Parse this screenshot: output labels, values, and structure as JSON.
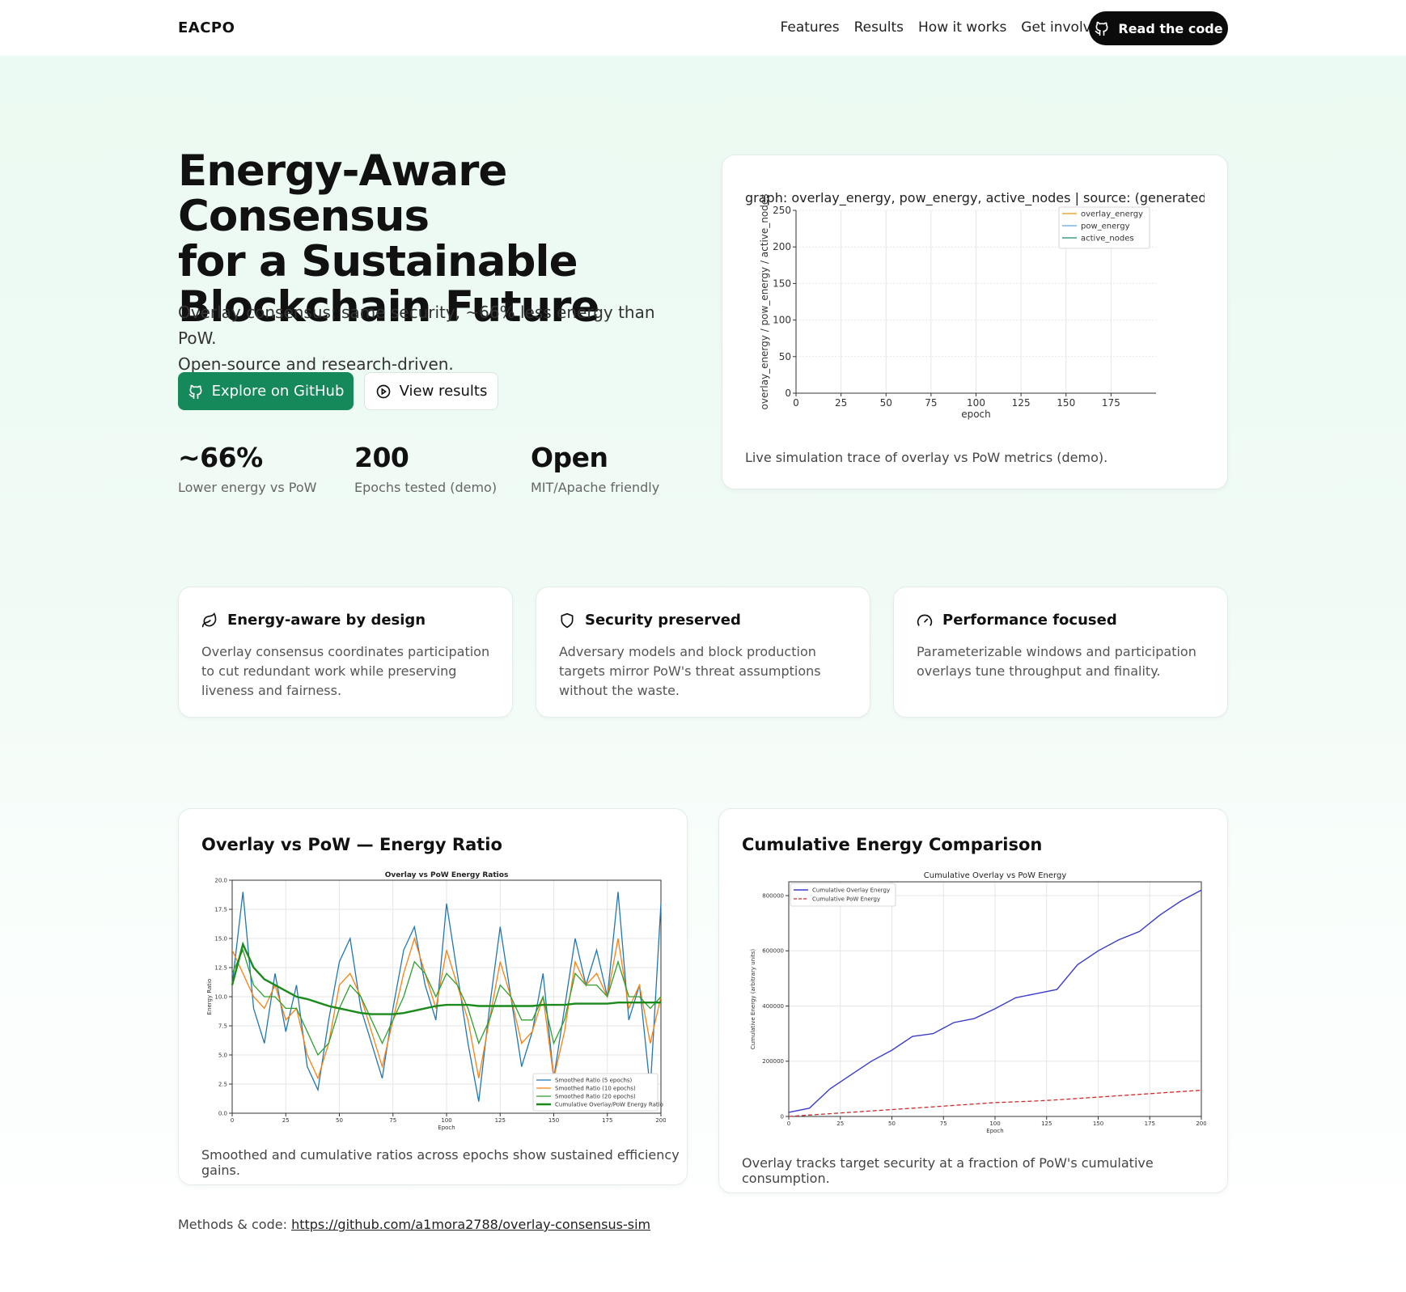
{
  "nav": {
    "brand": "EACPO",
    "links": [
      "Features",
      "Results",
      "How it works",
      "Get involved"
    ],
    "cta": "Read the code"
  },
  "hero": {
    "title_lines": [
      "Energy-Aware Consensus",
      "for a Sustainable",
      "Blockchain Future"
    ],
    "subtitle_lines": [
      "Overlay consensus: same security, ~66% less energy than PoW.",
      "Open-source and research-driven."
    ],
    "primary_button": "Explore on GitHub",
    "secondary_button": "View results",
    "stats": [
      {
        "value": "~66%",
        "label": "Lower energy vs PoW"
      },
      {
        "value": "200",
        "label": "Epochs tested (demo)"
      },
      {
        "value": "Open",
        "label": "MIT/Apache friendly"
      }
    ]
  },
  "live_chart": {
    "caption": "Live simulation trace of overlay vs PoW metrics (demo)."
  },
  "features": [
    {
      "icon": "leaf-icon",
      "title": "Energy-aware by design",
      "body": "Overlay consensus coordinates participation to cut redundant work while preserving liveness and fairness."
    },
    {
      "icon": "shield-icon",
      "title": "Security preserved",
      "body": "Adversary models and block production targets mirror PoW's threat assumptions without the waste."
    },
    {
      "icon": "gauge-icon",
      "title": "Performance focused",
      "body": "Parameterizable windows and participation overlays tune throughput and finality."
    }
  ],
  "results": {
    "ratio_card": {
      "title": "Overlay vs PoW — Energy Ratio",
      "caption": "Smoothed and cumulative ratios across epochs show sustained efficiency gains."
    },
    "cumulative_card": {
      "title": "Cumulative Energy Comparison",
      "caption": "Overlay tracks target security at a fraction of PoW's cumulative consumption."
    }
  },
  "footer": {
    "label": "Methods & code:",
    "link": "https://github.com/a1mora2788/overlay-consensus-sim"
  },
  "colors": {
    "accent": "#16895a",
    "dark": "#0b0b0b",
    "overlay_energy": "#e8a838",
    "pow_energy": "#7fb3e0",
    "active_nodes": "#3aa08e"
  },
  "chart_data": [
    {
      "type": "line",
      "title": "graph: overlay_energy, pow_energy, active_nodes  |  source: (generated de",
      "xlabel": "epoch",
      "ylabel": "overlay_energy / pow_energy / active_nodes",
      "xlim": [
        0,
        200
      ],
      "ylim": [
        0,
        250
      ],
      "xticks": [
        0,
        25,
        50,
        75,
        100,
        125,
        150,
        175
      ],
      "yticks": [
        0,
        50,
        100,
        150,
        200,
        250
      ],
      "grid": true,
      "legend": "top-right",
      "series": [
        {
          "name": "overlay_energy",
          "color": "#e8a838",
          "values": []
        },
        {
          "name": "pow_energy",
          "color": "#7fb3e0",
          "values": []
        },
        {
          "name": "active_nodes",
          "color": "#3aa08e",
          "values": []
        }
      ]
    },
    {
      "type": "line",
      "title": "Overlay vs PoW Energy Ratios",
      "xlabel": "Epoch",
      "ylabel": "Energy Ratio",
      "xlim": [
        0,
        200
      ],
      "ylim": [
        0,
        20
      ],
      "xticks": [
        0,
        25,
        50,
        75,
        100,
        125,
        150,
        175,
        200
      ],
      "yticks": [
        0.0,
        2.5,
        5.0,
        7.5,
        10.0,
        12.5,
        15.0,
        17.5,
        20.0
      ],
      "grid": true,
      "legend": "bottom-right",
      "x": [
        0,
        5,
        10,
        15,
        20,
        25,
        30,
        35,
        40,
        45,
        50,
        55,
        60,
        65,
        70,
        75,
        80,
        85,
        90,
        95,
        100,
        105,
        110,
        115,
        120,
        125,
        130,
        135,
        140,
        145,
        150,
        155,
        160,
        165,
        170,
        175,
        180,
        185,
        190,
        195,
        200
      ],
      "series": [
        {
          "name": "Smoothed Ratio (5 epochs)",
          "color": "#1f77b4",
          "values": [
            11,
            19,
            9,
            6,
            12,
            7,
            11,
            4,
            2,
            8,
            13,
            15,
            9,
            6,
            3,
            9,
            14,
            16,
            11,
            8,
            18,
            12,
            6,
            1,
            9,
            16,
            10,
            4,
            7,
            12,
            3,
            9,
            15,
            11,
            14,
            10,
            19,
            8,
            11,
            2,
            18
          ]
        },
        {
          "name": "Smoothed Ratio (10 epochs)",
          "color": "#ff7f0e",
          "values": [
            14,
            12,
            10,
            9,
            11,
            8,
            9,
            5,
            3,
            6,
            11,
            12,
            10,
            7,
            4,
            8,
            12,
            15,
            12,
            9,
            14,
            11,
            8,
            3,
            8,
            13,
            10,
            6,
            7,
            10,
            3,
            7,
            13,
            11,
            12,
            10,
            15,
            9,
            11,
            6,
            10
          ]
        },
        {
          "name": "Smoothed Ratio (20 epochs)",
          "color": "#2ca02c",
          "values": [
            12,
            14,
            11,
            10,
            10,
            9,
            9,
            7,
            5,
            6,
            9,
            11,
            10,
            8,
            6,
            8,
            10,
            13,
            12,
            10,
            12,
            11,
            9,
            6,
            8,
            11,
            10,
            8,
            8,
            10,
            6,
            8,
            12,
            11,
            11,
            10,
            13,
            10,
            10,
            9,
            10
          ]
        },
        {
          "name": "Cumulative Overlay/PoW Energy Ratio",
          "color": "#1a8a1a",
          "values": [
            11,
            14.5,
            12.5,
            11.5,
            11,
            10.5,
            10,
            9.8,
            9.5,
            9.2,
            9,
            8.8,
            8.6,
            8.5,
            8.5,
            8.5,
            8.6,
            8.8,
            9,
            9.2,
            9.3,
            9.3,
            9.3,
            9.2,
            9.2,
            9.2,
            9.2,
            9.2,
            9.2,
            9.3,
            9.3,
            9.3,
            9.4,
            9.4,
            9.4,
            9.4,
            9.5,
            9.5,
            9.5,
            9.5,
            9.5
          ]
        }
      ]
    },
    {
      "type": "line",
      "title": "Cumulative Overlay vs PoW Energy",
      "xlabel": "Epoch",
      "ylabel": "Cumulative Energy (arbitrary units)",
      "xlim": [
        0,
        200
      ],
      "ylim": [
        0,
        850000
      ],
      "xticks": [
        0,
        25,
        50,
        75,
        100,
        125,
        150,
        175,
        200
      ],
      "yticks": [
        0,
        200000,
        400000,
        600000,
        800000
      ],
      "grid": true,
      "legend": "top-left",
      "x": [
        0,
        10,
        20,
        30,
        40,
        50,
        60,
        70,
        80,
        90,
        100,
        110,
        120,
        130,
        140,
        150,
        160,
        170,
        180,
        190,
        200
      ],
      "series": [
        {
          "name": "Cumulative Overlay Energy",
          "color": "#3b3bcc",
          "values": [
            15000,
            30000,
            100000,
            150000,
            200000,
            240000,
            290000,
            300000,
            340000,
            355000,
            390000,
            430000,
            445000,
            460000,
            550000,
            600000,
            640000,
            670000,
            730000,
            780000,
            820000
          ]
        },
        {
          "name": "Cumulative PoW Energy",
          "color": "#d62728",
          "values": [
            0,
            5000,
            10000,
            15000,
            20000,
            25000,
            30000,
            35000,
            40000,
            45000,
            50000,
            53000,
            56000,
            60000,
            65000,
            70000,
            75000,
            80000,
            85000,
            90000,
            95000
          ]
        }
      ]
    }
  ]
}
